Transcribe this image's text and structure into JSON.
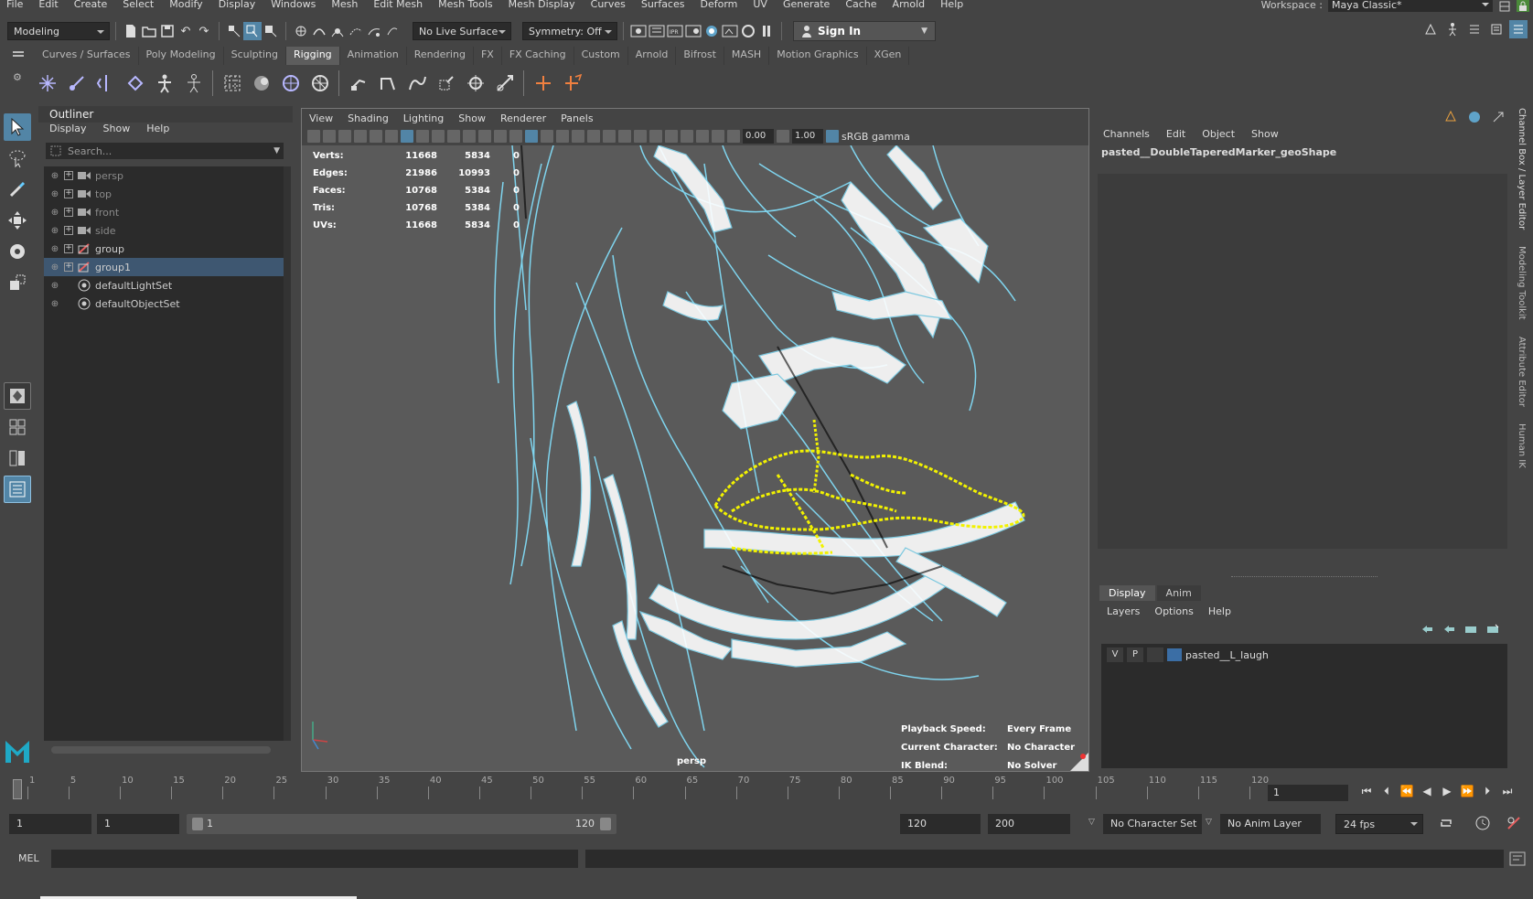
{
  "menubar": {
    "items": [
      "File",
      "Edit",
      "Create",
      "Select",
      "Modify",
      "Display",
      "Windows",
      "Mesh",
      "Edit Mesh",
      "Mesh Tools",
      "Mesh Display",
      "Curves",
      "Surfaces",
      "Deform",
      "UV",
      "Generate",
      "Cache",
      "Arnold",
      "Help"
    ],
    "workspace_label": "Workspace :",
    "workspace_value": "Maya Classic*"
  },
  "statusline": {
    "mode": "Modeling",
    "live_surface": "No Live Surface",
    "symmetry": "Symmetry: Off",
    "sign_in": "Sign In"
  },
  "shelf": {
    "tabs": [
      "Curves / Surfaces",
      "Poly Modeling",
      "Sculpting",
      "Rigging",
      "Animation",
      "Rendering",
      "FX",
      "FX Caching",
      "Custom",
      "Arnold",
      "Bifrost",
      "MASH",
      "Motion Graphics",
      "XGen"
    ],
    "active_tab": "Rigging"
  },
  "outliner": {
    "title": "Outliner",
    "menu": [
      "Display",
      "Show",
      "Help"
    ],
    "search_placeholder": "Search...",
    "items": [
      {
        "name": "persp",
        "icon": "camera-icon",
        "dim": true
      },
      {
        "name": "top",
        "icon": "camera-icon",
        "dim": true
      },
      {
        "name": "front",
        "icon": "camera-icon",
        "dim": true
      },
      {
        "name": "side",
        "icon": "camera-icon",
        "dim": true
      },
      {
        "name": "group",
        "icon": "group-icon",
        "dim": false
      },
      {
        "name": "group1",
        "icon": "group-icon",
        "dim": false,
        "selected": true
      },
      {
        "name": "defaultLightSet",
        "icon": "set-icon",
        "dim": false
      },
      {
        "name": "defaultObjectSet",
        "icon": "set-icon",
        "dim": false
      }
    ]
  },
  "viewport": {
    "menu": [
      "View",
      "Shading",
      "Lighting",
      "Show",
      "Renderer",
      "Panels"
    ],
    "near_value": "0.00",
    "far_value": "1.00",
    "color_space": "sRGB gamma",
    "hud": [
      {
        "label": "Verts:",
        "a": "11668",
        "b": "5834",
        "c": "0"
      },
      {
        "label": "Edges:",
        "a": "21986",
        "b": "10993",
        "c": "0"
      },
      {
        "label": "Faces:",
        "a": "10768",
        "b": "5384",
        "c": "0"
      },
      {
        "label": "Tris:",
        "a": "10768",
        "b": "5384",
        "c": "0"
      },
      {
        "label": "UVs:",
        "a": "11668",
        "b": "5834",
        "c": "0"
      }
    ],
    "play_hud": [
      {
        "label": "Playback Speed:",
        "value": "Every Frame"
      },
      {
        "label": "Current Character:",
        "value": "No Character"
      },
      {
        "label": "IK Blend:",
        "value": "No Solver"
      }
    ],
    "camera": "persp",
    "wire_color": "#7fd4ee",
    "highlight_color": "#f2f200"
  },
  "channelbox": {
    "menu": [
      "Channels",
      "Edit",
      "Object",
      "Show"
    ],
    "object_name": "pasted__DoubleTaperedMarker_geoShape",
    "layer_tabs": [
      "Display",
      "Anim"
    ],
    "layer_menu": [
      "Layers",
      "Options",
      "Help"
    ],
    "layer": {
      "v": "V",
      "p": "P",
      "name": "pasted__L_laugh",
      "color": "#3b6ea5"
    }
  },
  "right_tabs": [
    "Channel Box / Layer Editor",
    "Modeling Toolkit",
    "Attribute Editor",
    "Human IK"
  ],
  "timeline": {
    "ticks": [
      "1",
      "5",
      "10",
      "15",
      "20",
      "25",
      "30",
      "35",
      "40",
      "45",
      "50",
      "55",
      "60",
      "65",
      "70",
      "75",
      "80",
      "85",
      "90",
      "95",
      "100",
      "105",
      "110",
      "115",
      "120"
    ],
    "current_frame": "1"
  },
  "range": {
    "start": "1",
    "playback_start": "1",
    "slider_start": "1",
    "slider_end": "120",
    "playback_end": "120",
    "end": "200",
    "character_set": "No Character Set",
    "anim_layer": "No Anim Layer",
    "fps": "24 fps"
  },
  "cmdline": {
    "label": "MEL"
  }
}
